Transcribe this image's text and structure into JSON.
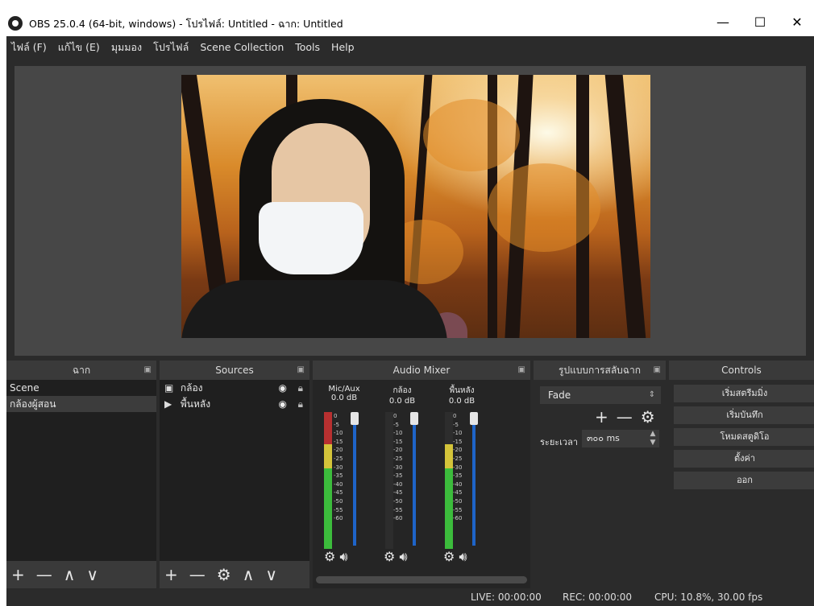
{
  "window": {
    "title": "OBS 25.0.4 (64-bit, windows) - โปรไฟล์: Untitled - ฉาก: Untitled",
    "minimize": "—",
    "maximize": "☐",
    "close": "✕"
  },
  "menu": [
    "ไฟล์ (F)",
    "แก้ไข (E)",
    "มุมมอง",
    "โปรไฟล์",
    "Scene Collection",
    "Tools",
    "Help"
  ],
  "scenes": {
    "title": "ฉาก",
    "items": [
      "Scene",
      "กล้องผู้สอน"
    ],
    "footer": [
      "+",
      "—",
      "∧",
      "∨"
    ]
  },
  "sources": {
    "title": "Sources",
    "items": [
      {
        "icon": "camera-icon",
        "glyph": "▣",
        "label": "กล้อง"
      },
      {
        "icon": "play-icon",
        "glyph": "▶",
        "label": "พื้นหลัง"
      }
    ],
    "footer": [
      "+",
      "—",
      "⚙",
      "∧",
      "∨"
    ]
  },
  "mixer": {
    "title": "Audio Mixer",
    "channels": [
      {
        "name": "Mic/Aux",
        "db": "0.0 dB"
      },
      {
        "name": "กล้อง",
        "db": "0.0 dB"
      },
      {
        "name": "พื้นหลัง",
        "db": "0.0 dB"
      }
    ],
    "ticks": [
      "0",
      "-5",
      "-10",
      "-15",
      "-20",
      "-25",
      "-30",
      "-35",
      "-40",
      "-45",
      "-50",
      "-55",
      "-60"
    ]
  },
  "transitions": {
    "title": "รูปแบบการสลับฉาก",
    "selected": "Fade",
    "duration_label": "ระยะเวลา",
    "duration_value": "๓๐๐ ms"
  },
  "controls": {
    "title": "Controls",
    "buttons": [
      "เริ่มสตรีมมิ่ง",
      "เริ่มบันทึก",
      "โหมดสตูดิโอ",
      "ตั้งค่า",
      "ออก"
    ]
  },
  "status": {
    "live": "LIVE: 00:00:00",
    "rec": "REC: 00:00:00",
    "cpu": "CPU: 10.8%, 30.00 fps"
  }
}
